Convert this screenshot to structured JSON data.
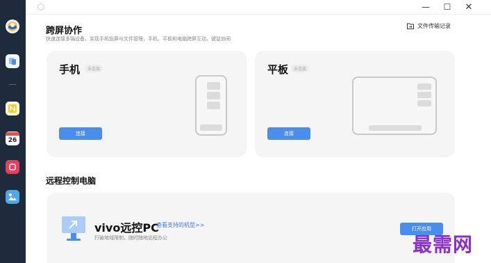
{
  "sidebar": {
    "calendar_day": "26"
  },
  "window": {
    "minimize_glyph": "—",
    "maximize_glyph": "☐",
    "close_glyph": "✕"
  },
  "header": {
    "title": "跨屏协作",
    "subtitle": "快速连接多端设备，实现手机投屏与文件管理，手机、平板和电脑跨屏互动，键鼠协同",
    "transfer_link": "文件传输记录"
  },
  "phone_card": {
    "title": "手机",
    "status": "未连接",
    "button": "连接"
  },
  "tablet_card": {
    "title": "平板",
    "status": "未连接",
    "button": "连接"
  },
  "remote": {
    "section_title": "远程控制电脑",
    "app_name": "vivo远控PC",
    "models_link": "查看支持的机型>>",
    "description": "打破地域限制，随时随地远程办公",
    "open_button": "打开应用"
  },
  "watermark": "最需网",
  "colors": {
    "accent": "#4a8eed",
    "sidebar_bg": "#1e2b3d",
    "card_bg": "#f5f5f5"
  }
}
